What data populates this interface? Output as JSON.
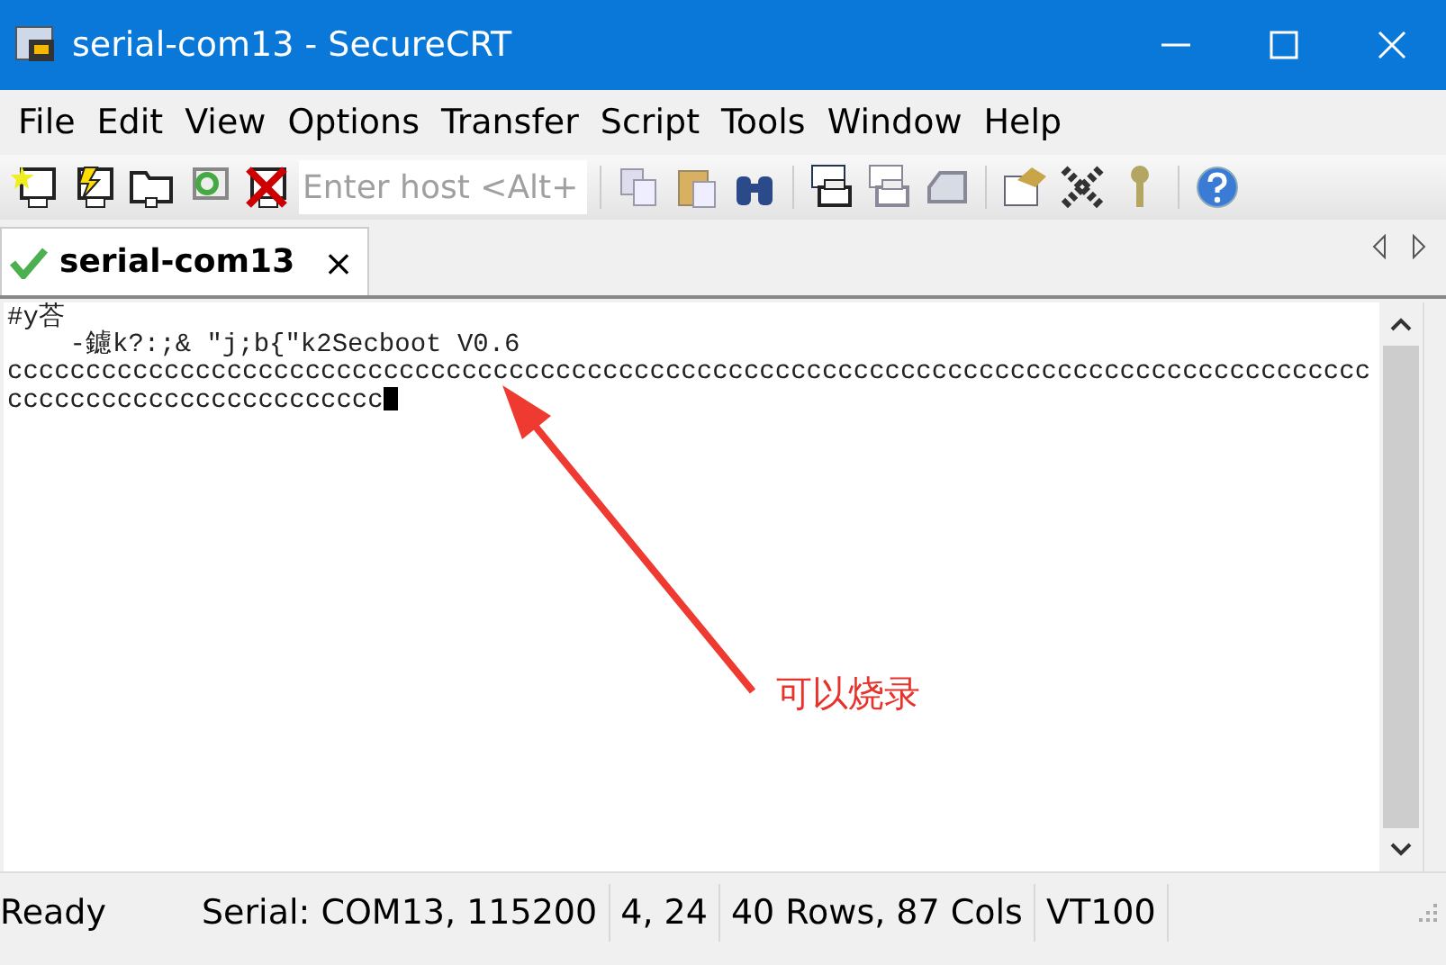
{
  "window": {
    "title": "serial-com13 - SecureCRT"
  },
  "menu": [
    "File",
    "Edit",
    "View",
    "Options",
    "Transfer",
    "Script",
    "Tools",
    "Window",
    "Help"
  ],
  "toolbar": {
    "host_field": {
      "placeholder": "Enter host <Alt+"
    }
  },
  "tabs": [
    {
      "label": "serial-com13",
      "selected": true,
      "connected": true,
      "close": "×"
    }
  ],
  "terminal": {
    "lines": [
      "#y荅",
      "    -鑢k?:;& \"j;b{\"k2Secboot V0.6",
      "ccccccccccccccccccccccccccccccccccccccccccccccccccccccccccccccccccccccccccccccccccccccc",
      "cccccccccccccccccccccccc"
    ]
  },
  "annotation": {
    "text": "可以烧录"
  },
  "status_bar": [
    "Ready",
    "Serial: COM13, 115200",
    "4,  24",
    "40 Rows, 87 Cols",
    "VT100"
  ]
}
